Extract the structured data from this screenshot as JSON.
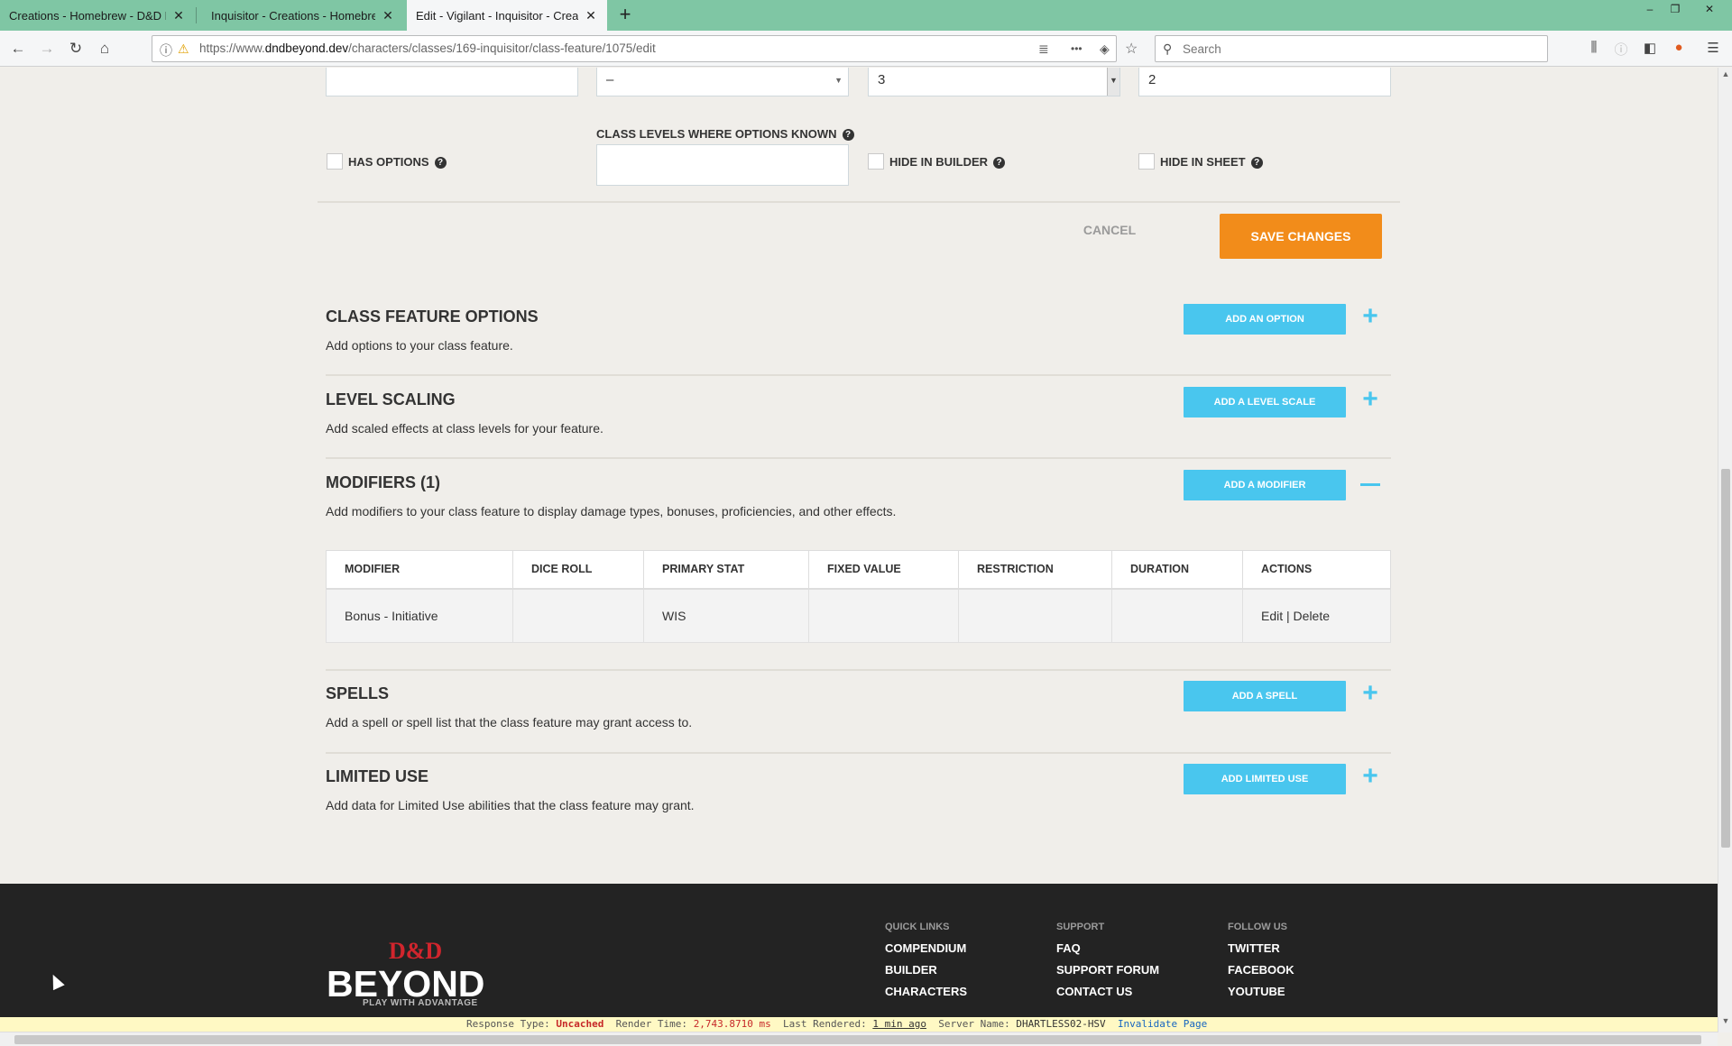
{
  "browser": {
    "tabs": [
      {
        "title": "Creations - Homebrew - D&D Beyo",
        "active": false
      },
      {
        "title": "Inquisitor - Creations - Homebrew",
        "active": false
      },
      {
        "title": "Edit - Vigilant - Inquisitor - Creation",
        "active": true
      }
    ],
    "new_tab_symbol": "+",
    "url_prefix": "https://www.",
    "url_domain": "dndbeyond.dev",
    "url_path": "/characters/classes/169-inquisitor/class-feature/1075/edit",
    "search_placeholder": "Search",
    "tab_close_symbol": "✕",
    "window_controls": [
      "–",
      "❐",
      "✕"
    ],
    "nav_icons": {
      "back": "←",
      "forward": "→",
      "reload": "↻",
      "home": "⌂"
    },
    "toolbar_icons": {
      "reader": "≣",
      "more": "•••",
      "pocket": "◈",
      "bookmark": "☆",
      "library": "⫼",
      "info": "ⓘ",
      "sidebar": "◧",
      "extension": "●",
      "menu": "☰"
    }
  },
  "form": {
    "field1_value": "",
    "select_value": "–",
    "number_value": "3",
    "field4_value": "2",
    "has_options_label": "HAS OPTIONS",
    "class_levels_label": "CLASS LEVELS WHERE OPTIONS KNOWN",
    "class_levels_value": "",
    "hide_in_builder_label": "HIDE IN BUILDER",
    "hide_in_sheet_label": "HIDE IN SHEET",
    "cancel_label": "CANCEL",
    "save_label": "SAVE CHANGES",
    "help_symbol": "?"
  },
  "sections": {
    "class_feature_options": {
      "title": "CLASS FEATURE OPTIONS",
      "desc": "Add options to your class feature.",
      "button": "ADD AN OPTION",
      "toggle": "+"
    },
    "level_scaling": {
      "title": "LEVEL SCALING",
      "desc": "Add scaled effects at class levels for your feature.",
      "button": "ADD A LEVEL SCALE",
      "toggle": "+"
    },
    "modifiers": {
      "title": "MODIFIERS (1)",
      "desc": "Add modifiers to your class feature to display damage types, bonuses, proficiencies, and other effects.",
      "button": "ADD A MODIFIER",
      "toggle": "−"
    },
    "spells": {
      "title": "SPELLS",
      "desc": "Add a spell or spell list that the class feature may grant access to.",
      "button": "ADD A SPELL",
      "toggle": "+"
    },
    "limited_use": {
      "title": "LIMITED USE",
      "desc": "Add data for Limited Use abilities that the class feature may grant.",
      "button": "ADD LIMITED USE",
      "toggle": "+"
    }
  },
  "modifiers_table": {
    "headers": [
      "MODIFIER",
      "DICE ROLL",
      "PRIMARY STAT",
      "FIXED VALUE",
      "RESTRICTION",
      "DURATION",
      "ACTIONS"
    ],
    "rows": [
      {
        "modifier": "Bonus - Initiative",
        "dice_roll": "",
        "primary_stat": "WIS",
        "fixed_value": "",
        "restriction": "",
        "duration": "",
        "edit": "Edit",
        "sep": " | ",
        "delete": "Delete"
      }
    ]
  },
  "footer": {
    "logo_dd": "D&D",
    "logo_beyond": "BEYOND",
    "logo_tagline": "PLAY WITH ADVANTAGE",
    "quick_links": {
      "heading": "QUICK LINKS",
      "items": [
        "COMPENDIUM",
        "BUILDER",
        "CHARACTERS"
      ]
    },
    "support": {
      "heading": "SUPPORT",
      "items": [
        "FAQ",
        "SUPPORT FORUM",
        "CONTACT US"
      ]
    },
    "follow_us": {
      "heading": "FOLLOW US",
      "items": [
        "TWITTER",
        "FACEBOOK",
        "YOUTUBE"
      ]
    }
  },
  "debug": {
    "response_type_label": "Response Type:",
    "response_type_value": "Uncached",
    "render_time_label": "Render Time:",
    "render_time_value": "2,743.8710 ms",
    "last_rendered_label": "Last Rendered:",
    "last_rendered_value": "1 min ago",
    "server_name_label": "Server Name:",
    "server_name_value": "DHARTLESS02-HSV",
    "invalidate_label": "Invalidate Page"
  },
  "colors": {
    "tabbar": "#7fc6a4",
    "save": "#f28c1a",
    "accent_blue": "#49c6ee",
    "footer": "#232323",
    "logo_red": "#d1252d"
  }
}
